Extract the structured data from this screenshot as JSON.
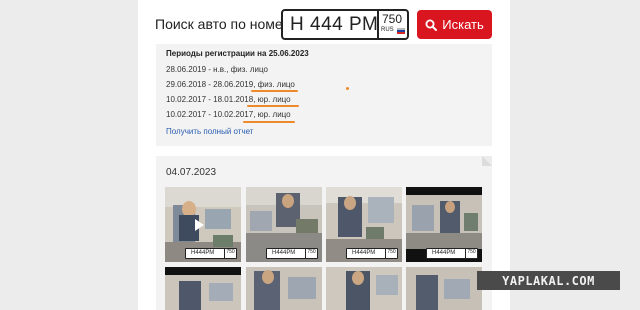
{
  "search": {
    "title": "Поиск авто по номеру",
    "plate_number": "Н 444 РМ",
    "plate_region": "750",
    "plate_country": "RUS",
    "button_label": "Искать",
    "button_color": "#d9151f",
    "button_icon": "search-icon"
  },
  "registration": {
    "header": "Периоды регистрации на 25.06.2023",
    "periods": [
      "28.06.2019 - н.в., физ. лицо",
      "29.06.2018 - 28.06.2019, физ. лицо",
      "10.02.2017 - 18.01.2018, юр. лицо",
      "10.02.2017 - 10.02.2017, юр. лицо"
    ],
    "full_report_link": "Получить полный отчет",
    "highlight_color": "#ee8a2c"
  },
  "photos": {
    "date": "04.07.2023",
    "plate_label": "Н444РМ",
    "plate_region": "750",
    "thumbnails_row1": 4,
    "thumbnails_row2": 4
  },
  "watermark": {
    "text": "YAPLAKAL.COM"
  }
}
